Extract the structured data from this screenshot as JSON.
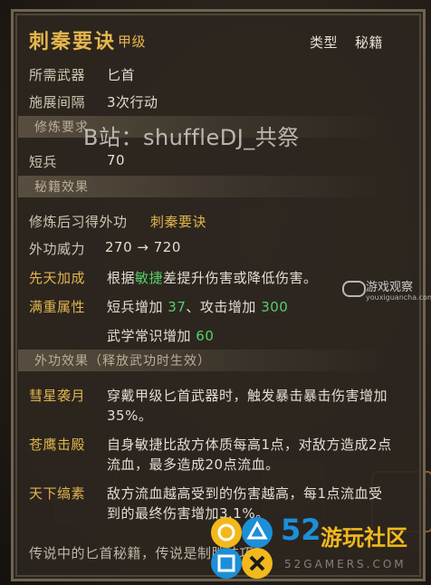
{
  "skill": {
    "name": "刺秦要诀",
    "grade": "甲级",
    "type_label": "类型",
    "type_value": "秘籍"
  },
  "stats": {
    "weapon_label": "所需武器",
    "weapon_value": "匕首",
    "interval_label": "施展间隔",
    "interval_value": "3次行动"
  },
  "sections": {
    "requirements": "修炼要求",
    "effects": "秘籍效果",
    "external": "外功效果（释放武功时生效）"
  },
  "requirement": {
    "label": "短兵",
    "value": "70"
  },
  "effects": {
    "learn_label": "修炼后习得外功",
    "learn_value": "刺秦要诀",
    "power_label": "外功威力",
    "power_value": "270 → 720",
    "innate_label": "先天加成",
    "innate_pre": "根据",
    "innate_highlight": "敏捷",
    "innate_post": "差提升伤害或降低伤害。",
    "full_label": "满重属性",
    "full_line1_a": "短兵增加",
    "full_line1_a_val": "37",
    "full_line1_b": "、攻击增加",
    "full_line1_b_val": "300",
    "full_line2_a": "武学常识增加",
    "full_line2_a_val": "60"
  },
  "external": [
    {
      "label": "彗星袭月",
      "line1": "穿戴甲级匕首武器时，触发暴击暴击伤害增加",
      "line2": "35%。"
    },
    {
      "label": "苍鹰击殿",
      "line1": "自身敏捷比敌方体质每高1点，对敌方造成2点",
      "line2": "流血，最多造成20点流血。"
    },
    {
      "label": "天下缟素",
      "line1": "敌方流血越高受到的伤害越高，每1点流血受",
      "line2": "到的最终伤害增加3.1%。"
    }
  ],
  "footer": "传说中的匕首秘籍，传说是制胜技巧。",
  "watermarks": {
    "bilibili": "B站：shuffleDJ_共祭",
    "site_big": "52",
    "site_cn": "游玩社区",
    "site_url": "52GAMERS.COM",
    "site_right": "游戏观察",
    "site_right_url": "youxiguancha.com"
  },
  "colors": {
    "gold": "#e2b44e",
    "green": "#53d06a",
    "text": "#d9d2c3",
    "panel": "#2c261f"
  }
}
